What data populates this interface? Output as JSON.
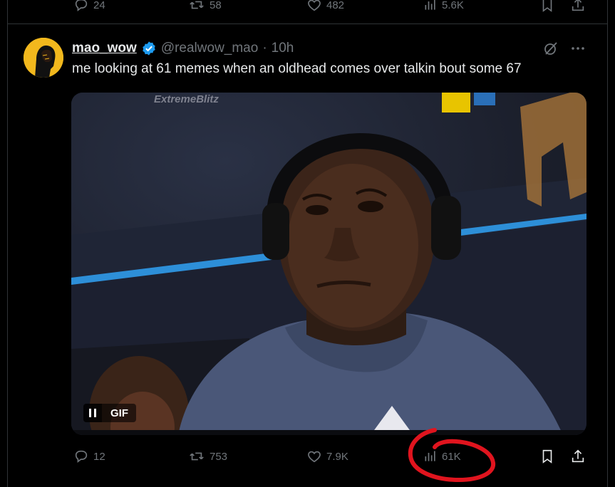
{
  "previous_tweet": {
    "replies": "24",
    "reposts": "58",
    "likes": "482",
    "views": "5.6K"
  },
  "tweet": {
    "display_name": "mao_wow",
    "verified": true,
    "handle": "@realwow_mao",
    "separator": "·",
    "time": "10h",
    "text": "me looking at 61 memes when an oldhead comes over talkin bout some 67",
    "media": {
      "type": "GIF",
      "gif_label": "GIF",
      "watermark": "ExtremeBlitz"
    },
    "stats": {
      "replies": "12",
      "reposts": "753",
      "likes": "7.9K",
      "views": "61K"
    }
  },
  "colors": {
    "background": "#000000",
    "text": "#e7e9ea",
    "muted": "#71767b",
    "verified": "#1d9bf0",
    "annotation": "#e0141e"
  }
}
